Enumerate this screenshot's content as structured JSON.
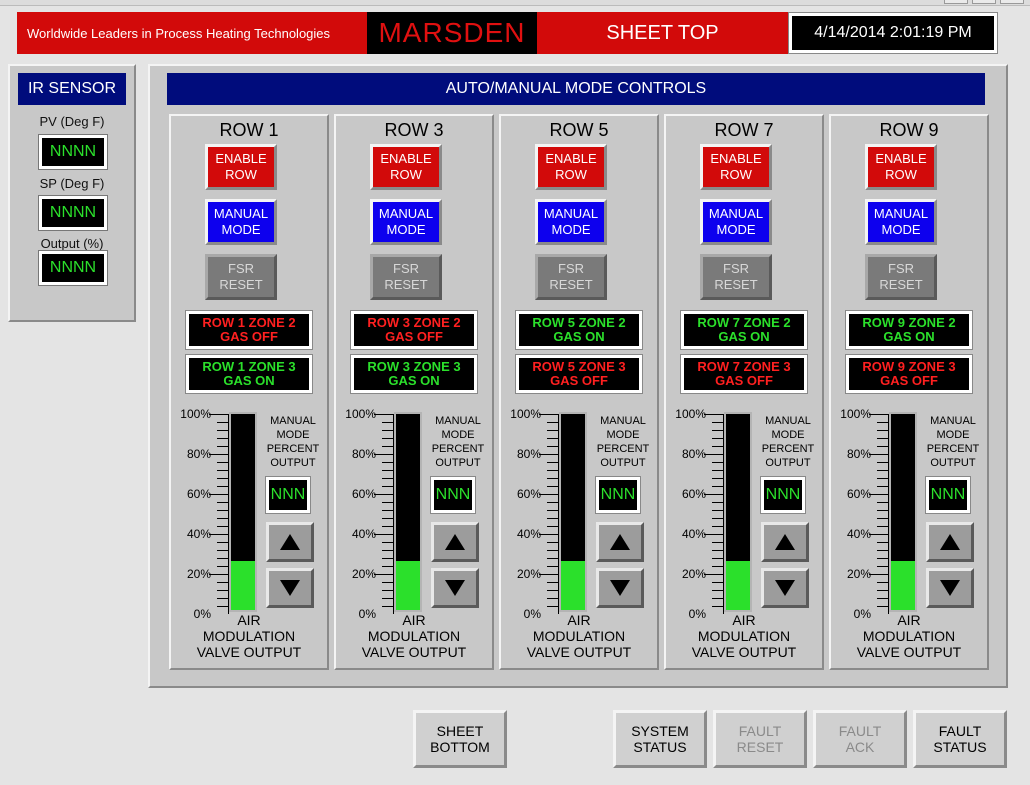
{
  "header": {
    "tagline": "Worldwide Leaders in Process Heating Technologies",
    "logo": "MARSDEN",
    "page_title": "SHEET TOP",
    "datetime": "4/14/2014 2:01:19 PM"
  },
  "ir_sensor": {
    "title": "IR SENSOR",
    "pv_label": "PV (Deg F)",
    "pv_value": "NNNN",
    "sp_label": "SP (Deg F)",
    "sp_value": "NNNN",
    "output_label": "Output (%)",
    "output_value": "NNNN"
  },
  "main": {
    "title": "AUTO/MANUAL MODE CONTROLS",
    "enable_label": "ENABLE\nROW",
    "manual_label": "MANUAL\nMODE",
    "fsr_label": "FSR\nRESET",
    "mm_label": "MANUAL\nMODE\nPERCENT\nOUTPUT",
    "nnn": "NNN",
    "amv_label": "AIR\nMODULATION\nVALVE OUTPUT",
    "scale_ticks": [
      "100%",
      "80%",
      "60%",
      "40%",
      "20%",
      "0%"
    ],
    "rows": [
      {
        "name": "ROW 1",
        "zone2": "ROW 1 ZONE 2\nGAS OFF",
        "zone2_on": false,
        "zone3": "ROW 1 ZONE 3\nGAS ON",
        "zone3_on": true,
        "valve_pct": 0.25
      },
      {
        "name": "ROW 3",
        "zone2": "ROW 3 ZONE 2\nGAS OFF",
        "zone2_on": false,
        "zone3": "ROW 3 ZONE 3\nGAS ON",
        "zone3_on": true,
        "valve_pct": 0.25
      },
      {
        "name": "ROW 5",
        "zone2": "ROW 5 ZONE 2\nGAS ON",
        "zone2_on": true,
        "zone3": "ROW 5 ZONE 3\nGAS OFF",
        "zone3_on": false,
        "valve_pct": 0.25
      },
      {
        "name": "ROW 7",
        "zone2": "ROW 7 ZONE 2\nGAS ON",
        "zone2_on": true,
        "zone3": "ROW 7 ZONE 3\nGAS OFF",
        "zone3_on": false,
        "valve_pct": 0.25
      },
      {
        "name": "ROW 9",
        "zone2": "ROW 9 ZONE 2\nGAS ON",
        "zone2_on": true,
        "zone3": "ROW 9 ZONE 3\nGAS OFF",
        "zone3_on": false,
        "valve_pct": 0.25
      }
    ]
  },
  "footer": {
    "sheet_bottom": "SHEET\nBOTTOM",
    "system_status": "SYSTEM\nSTATUS",
    "fault_reset": "FAULT\nRESET",
    "fault_ack": "FAULT\nACK",
    "fault_status": "FAULT\nSTATUS"
  },
  "colors": {
    "header_red": "#d20a0a",
    "panel_title_blue": "#000c7c",
    "status_on_green": "#2be02b",
    "status_off_red": "#ff2020",
    "manual_blue": "#0d00ee"
  }
}
